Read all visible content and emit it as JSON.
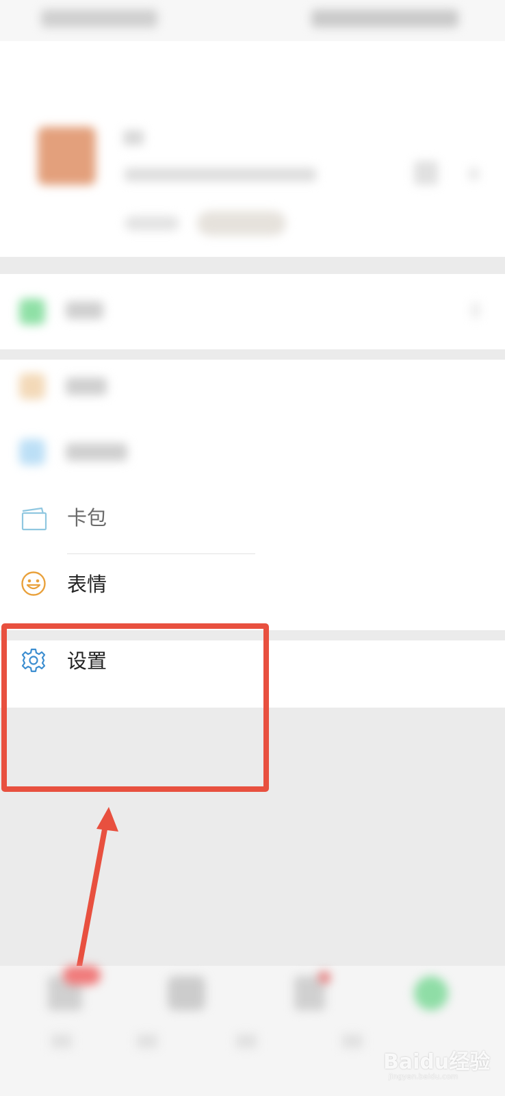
{
  "menu": {
    "card_label": "卡包",
    "emoji_label": "表情",
    "settings_label": "设置"
  },
  "watermark": {
    "brand": "Baidu经验",
    "url": "jingyan.baidu.com"
  },
  "highlight_color": "#e8503f",
  "icons": {
    "card": "card-wallet-icon",
    "emoji": "smiley-icon",
    "settings": "gear-icon"
  }
}
